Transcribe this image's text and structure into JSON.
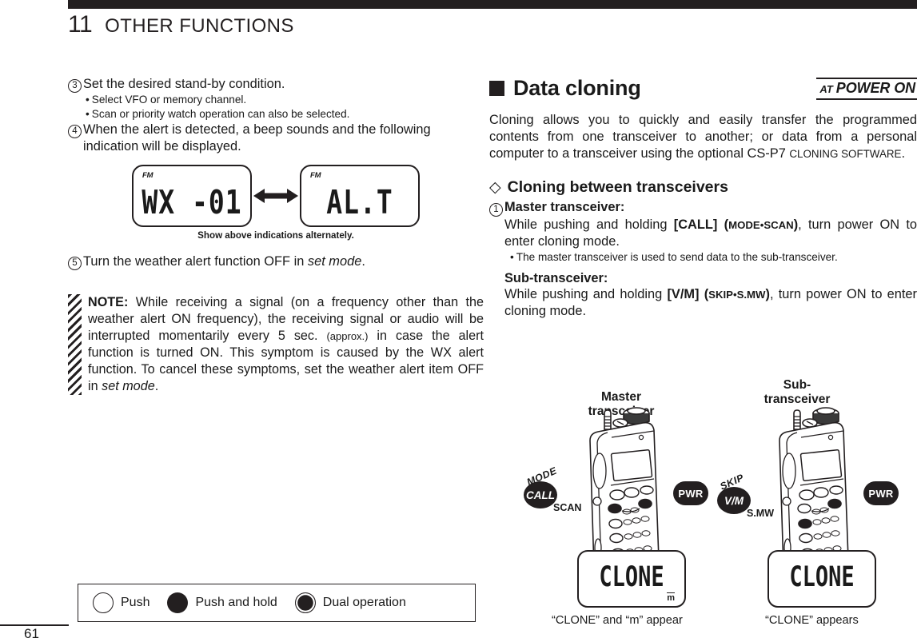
{
  "header": {
    "chapter_number": "11",
    "chapter_title": "OTHER FUNCTIONS"
  },
  "page_number": "61",
  "left_column": {
    "steps": [
      {
        "num": "3",
        "text": "Set the desired stand-by condition.",
        "bullets": [
          "Select VFO or memory channel.",
          "Scan or priority watch operation can also be selected."
        ]
      },
      {
        "num": "4",
        "text": "When the alert is detected, a beep sounds and the following indication will be displayed.",
        "bullets": []
      },
      {
        "num": "5",
        "text": "Turn the weather alert function OFF in set mode.",
        "bullets": []
      }
    ],
    "lcd_left": {
      "mode_flag": "FM",
      "segment_text": "WX -01"
    },
    "lcd_right": {
      "mode_flag": "FM",
      "segment_text": "AL.T"
    },
    "lcd_caption": "Show above indications alternately.",
    "note": {
      "label": "NOTE:",
      "part1": " While receiving a signal (on a frequency other than the weather alert ON frequency), the receiving signal or audio will be interrupted momentarily every 5 sec. ",
      "small": "(approx.)",
      "part2": " in case the alert function is turned ON. This symptom is caused by the WX alert function. To cancel these symptoms, set the weather alert item OFF in ",
      "italic_tail": "set mode",
      "period": "."
    },
    "legend": {
      "items": [
        {
          "icon": "circle-open-icon",
          "label": "Push"
        },
        {
          "icon": "circle-solid-icon",
          "label": "Push and hold"
        },
        {
          "icon": "circle-dual-icon",
          "label": "Dual operation"
        }
      ]
    }
  },
  "right_column": {
    "section_title": "Data cloning",
    "badge": {
      "prefix": "AT",
      "main": "POWER ON"
    },
    "intro": "Cloning allows you to quickly and easily transfer the programmed contents from one transceiver to another; or data from a personal computer to a transceiver using the optional CS-P7 ",
    "intro_smallcaps": "CLONING SOFTWARE",
    "intro_end": ".",
    "subsection_title": "Cloning between transceivers",
    "step1_num": "1",
    "master": {
      "heading": "Master transceiver:",
      "line_a": "While pushing and holding ",
      "key": "[CALL]",
      "key_paren_open": " (",
      "key_sub": "MODE•SCAN",
      "key_paren_close": ")",
      "line_b": ", turn power ON to enter cloning mode.",
      "bullet": "The master transceiver is used to send data to the sub-transceiver."
    },
    "sub": {
      "heading": "Sub-transceiver:",
      "line_a": "While pushing and holding ",
      "key": "[V/M]",
      "key_paren_open": " (",
      "key_sub": "SKIP•S.MW",
      "key_paren_close": ")",
      "line_b": ", turn power ON to enter cloning mode."
    },
    "illustration": {
      "master_label": "Master\ntransceiver",
      "sub_label": "Sub-\ntransceiver",
      "master_fn_button": {
        "arc": "MODE",
        "main": "CALL",
        "under": "SCAN"
      },
      "sub_fn_button": {
        "arc": "SKIP",
        "main": "V/M",
        "under": "S.MW"
      },
      "power_button_label": "PWR",
      "clone_lcd_left": {
        "segment_text": "CLONE",
        "indicator": "m"
      },
      "clone_lcd_right": {
        "segment_text": "CLONE",
        "indicator": ""
      },
      "caption_left": "“CLONE” and “m” appear",
      "caption_right": "“CLONE” appears"
    }
  },
  "colors": {
    "ink": "#231f20",
    "paper": "#ffffff"
  }
}
